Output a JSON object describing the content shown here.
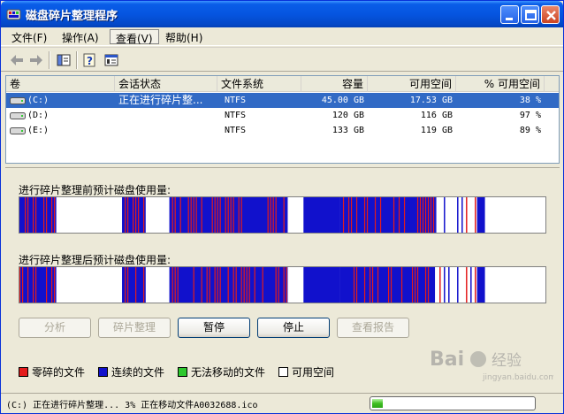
{
  "window": {
    "title": "磁盘碎片整理程序"
  },
  "menu": {
    "items": [
      {
        "label": "文件(F)"
      },
      {
        "label": "操作(A)"
      },
      {
        "label": "查看(V)"
      },
      {
        "label": "帮助(H)"
      }
    ],
    "active_index": 2
  },
  "toolbar": {
    "icons": [
      "back-icon",
      "forward-icon",
      "details-view-icon",
      "help-icon",
      "properties-icon"
    ]
  },
  "volumes": {
    "columns": [
      "卷",
      "会话状态",
      "文件系统",
      "容量",
      "可用空间",
      "% 可用空间"
    ],
    "rows": [
      {
        "volume": "(C:)",
        "status": "正在进行碎片整...",
        "fs": "NTFS",
        "capacity": "45.00 GB",
        "free": "17.53 GB",
        "pct": "38 %",
        "selected": true
      },
      {
        "volume": "(D:)",
        "status": "",
        "fs": "NTFS",
        "capacity": "120 GB",
        "free": "116 GB",
        "pct": "97 %",
        "selected": false
      },
      {
        "volume": "(E:)",
        "status": "",
        "fs": "NTFS",
        "capacity": "133 GB",
        "free": "119 GB",
        "pct": "89 %",
        "selected": false
      }
    ]
  },
  "analysis": {
    "before_label": "进行碎片整理前预计磁盘使用量:",
    "after_label": "进行碎片整理后预计磁盘使用量:",
    "usage_segments": [
      {
        "type": "mix",
        "start": 0.0,
        "end": 0.07
      },
      {
        "type": "free",
        "start": 0.07,
        "end": 0.195
      },
      {
        "type": "mix",
        "start": 0.195,
        "end": 0.24
      },
      {
        "type": "free",
        "start": 0.24,
        "end": 0.285
      },
      {
        "type": "mix",
        "start": 0.285,
        "end": 0.51
      },
      {
        "type": "free",
        "start": 0.51,
        "end": 0.54
      },
      {
        "type": "blue",
        "start": 0.54,
        "end": 0.61
      },
      {
        "type": "mix",
        "start": 0.61,
        "end": 0.79
      },
      {
        "type": "sparse",
        "start": 0.79,
        "end": 0.87
      },
      {
        "type": "blue",
        "start": 0.87,
        "end": 0.885
      },
      {
        "type": "free",
        "start": 0.885,
        "end": 1.0
      }
    ]
  },
  "buttons": [
    {
      "label": "分析",
      "enabled": false
    },
    {
      "label": "碎片整理",
      "enabled": false
    },
    {
      "label": "暂停",
      "enabled": true
    },
    {
      "label": "停止",
      "enabled": true
    },
    {
      "label": "查看报告",
      "enabled": false
    }
  ],
  "legend": [
    {
      "label": "零碎的文件",
      "color": "#e41c1c"
    },
    {
      "label": "连续的文件",
      "color": "#1111cc"
    },
    {
      "label": "无法移动的文件",
      "color": "#2ec82e"
    },
    {
      "label": "可用空间",
      "color": "#ffffff"
    }
  ],
  "statusbar": {
    "text": "(C:) 正在进行碎片整理... 3%  正在移动文件A0032688.ico",
    "progress": 0.03
  },
  "watermark": {
    "text": "Bai 经验",
    "sub": "jingyan.baidu.com"
  }
}
